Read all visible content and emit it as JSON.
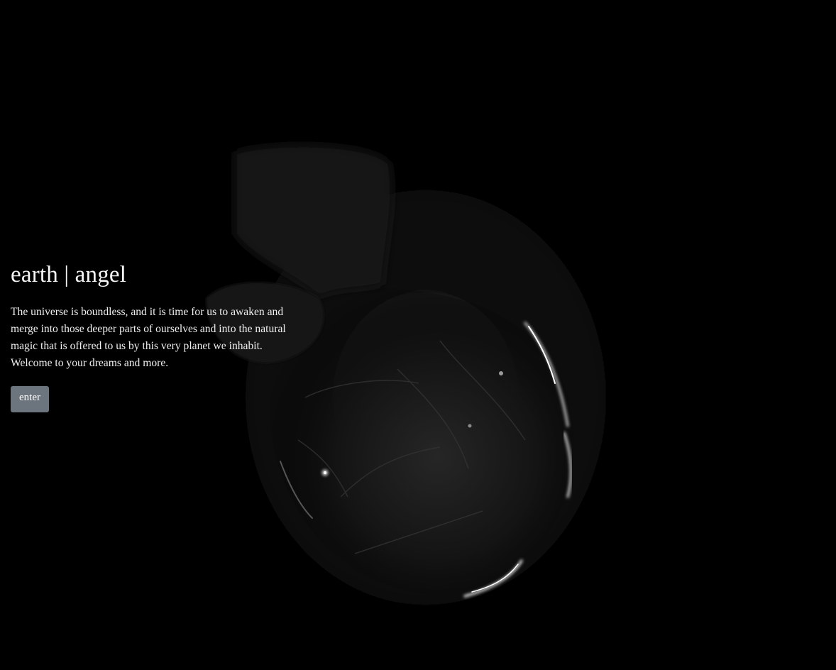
{
  "hero": {
    "title": "earth | angel",
    "description": "The universe is boundless, and it is time for us to awaken and merge into those deeper parts of ourselves and into the natural magic that is offered to us by this very planet we inhabit. Welcome to your dreams and more.",
    "enter_label": "enter"
  },
  "colors": {
    "background": "#000000",
    "button": "#6c757d",
    "text": "#f4f4f4"
  },
  "background_image": {
    "icon": "glass-heart-artwork"
  }
}
